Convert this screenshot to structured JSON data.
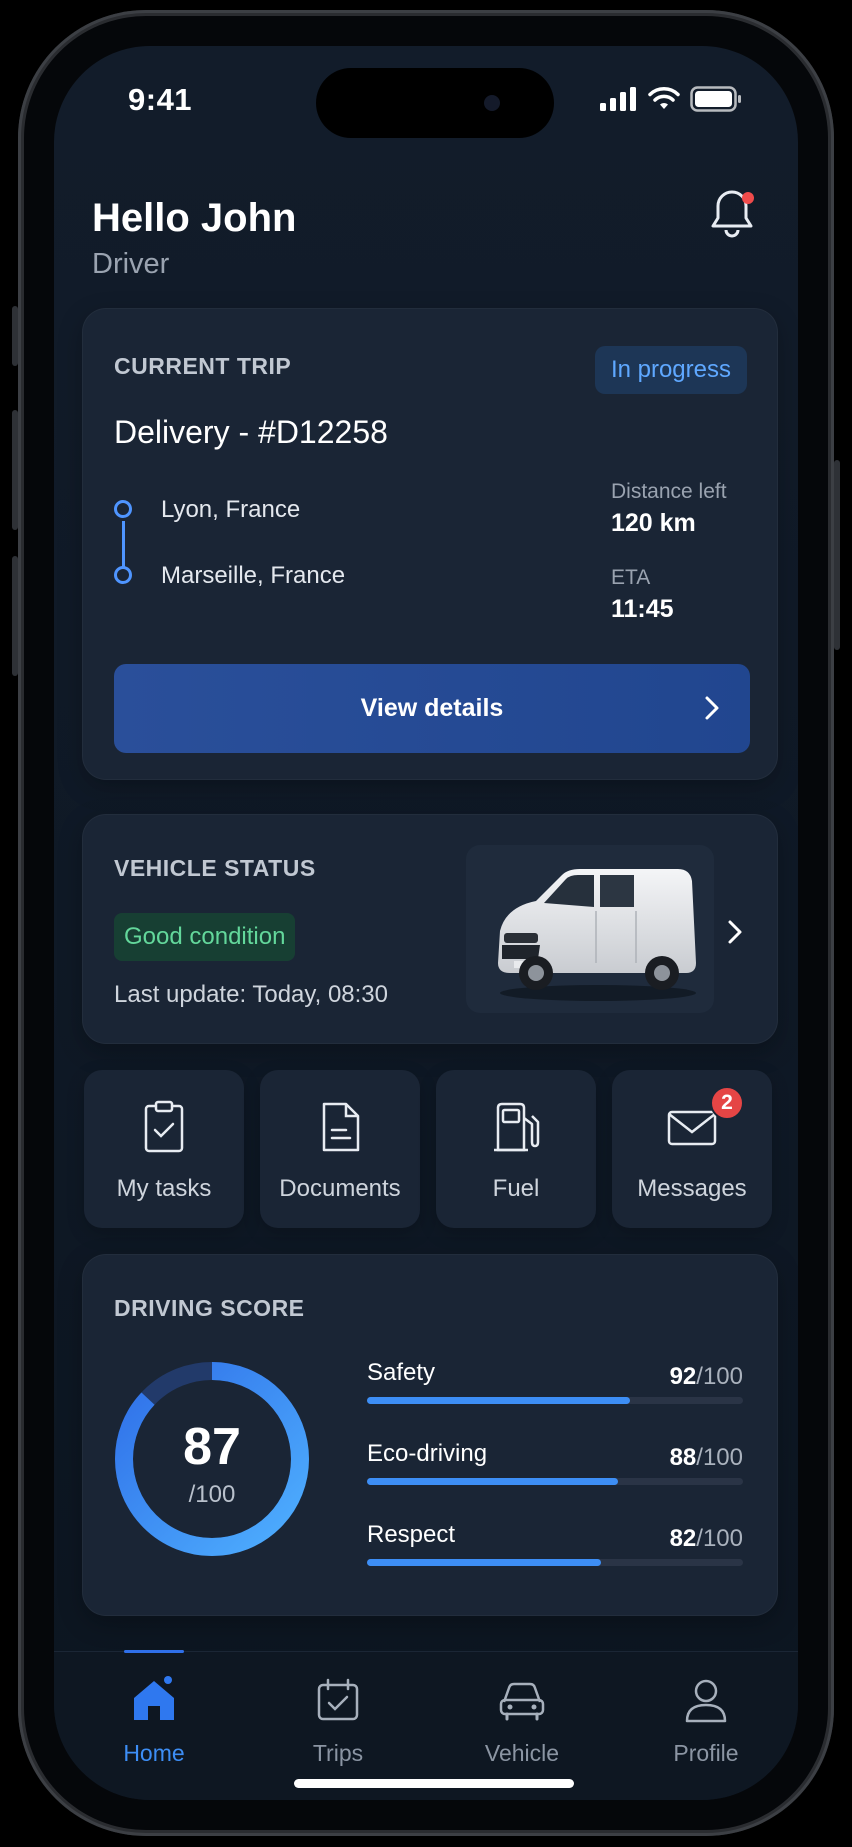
{
  "status_bar": {
    "time": "9:41"
  },
  "header": {
    "greeting": "Hello John",
    "role": "Driver"
  },
  "trip": {
    "section_label": "CURRENT TRIP",
    "status": "In progress",
    "title": "Delivery - #D12258",
    "origin": "Lyon, France",
    "destination": "Marseille, France",
    "distance_label": "Distance left",
    "distance_value": "120 km",
    "eta_label": "ETA",
    "eta_value": "11:45",
    "cta": "View details"
  },
  "vehicle": {
    "section_label": "VEHICLE STATUS",
    "condition": "Good condition",
    "last_update": "Last update: Today, 08:30"
  },
  "quick_actions": [
    {
      "label": "My tasks",
      "icon": "clipboard-check-icon"
    },
    {
      "label": "Documents",
      "icon": "document-icon"
    },
    {
      "label": "Fuel",
      "icon": "fuel-pump-icon"
    },
    {
      "label": "Messages",
      "icon": "mail-icon",
      "badge": "2"
    }
  ],
  "score": {
    "section_label": "DRIVING SCORE",
    "overall": "87",
    "overall_suffix": "/100",
    "metrics": [
      {
        "name": "Safety",
        "value": "92",
        "suffix": "/100"
      },
      {
        "name": "Eco-driving",
        "value": "88",
        "suffix": "/100"
      },
      {
        "name": "Respect",
        "value": "82",
        "suffix": "/100"
      }
    ]
  },
  "nav": [
    {
      "label": "Home",
      "icon": "home-icon",
      "active": true
    },
    {
      "label": "Trips",
      "icon": "calendar-check-icon"
    },
    {
      "label": "Vehicle",
      "icon": "car-icon"
    },
    {
      "label": "Profile",
      "icon": "user-icon"
    }
  ],
  "colors": {
    "accent": "#3d8ef5",
    "success": "#63d79b",
    "alert": "#e54545",
    "card": "#1a2535"
  }
}
